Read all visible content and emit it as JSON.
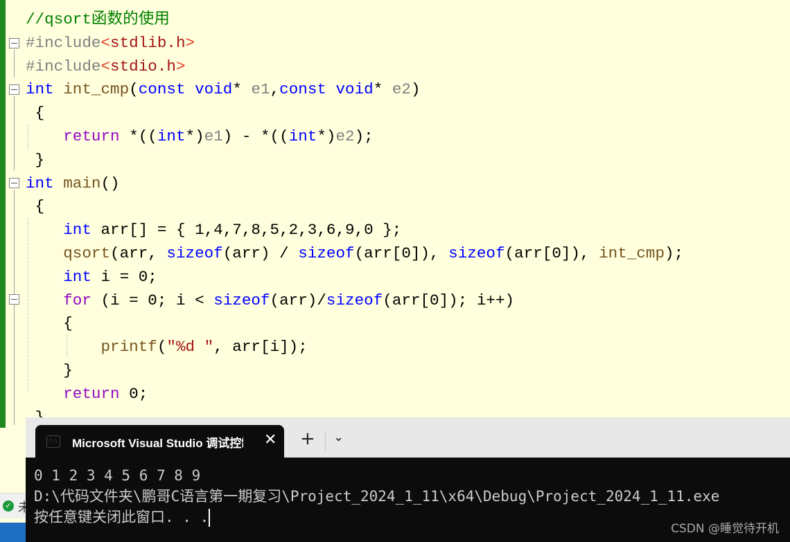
{
  "editor": {
    "lines": [
      [
        [
          "//qsort函数的使用",
          "c"
        ]
      ],
      [
        [
          "#include",
          "pp"
        ],
        [
          "<",
          "ang"
        ],
        [
          "stdlib.h",
          "inc"
        ],
        [
          ">",
          "ang"
        ]
      ],
      [
        [
          "#include",
          "pp"
        ],
        [
          "<",
          "ang"
        ],
        [
          "stdio.h",
          "inc"
        ],
        [
          ">",
          "ang"
        ]
      ],
      [
        [
          "int",
          "kw"
        ],
        [
          " ",
          "op"
        ],
        [
          "int_cmp",
          "fn"
        ],
        [
          "(",
          "op"
        ],
        [
          "const",
          "kw"
        ],
        [
          " ",
          "op"
        ],
        [
          "void",
          "kw"
        ],
        [
          "* ",
          "op"
        ],
        [
          "e1",
          "pr"
        ],
        [
          ",",
          "op"
        ],
        [
          "const",
          "kw"
        ],
        [
          " ",
          "op"
        ],
        [
          "void",
          "kw"
        ],
        [
          "* ",
          "op"
        ],
        [
          "e2",
          "pr"
        ],
        [
          ")",
          "op"
        ]
      ],
      [
        [
          " {",
          "op"
        ]
      ],
      [
        [
          "    ",
          "op"
        ],
        [
          "return",
          "rt"
        ],
        [
          " *((",
          "op"
        ],
        [
          "int",
          "kw"
        ],
        [
          "*)",
          "op"
        ],
        [
          "e1",
          "pr"
        ],
        [
          ") - *((",
          "op"
        ],
        [
          "int",
          "kw"
        ],
        [
          "*)",
          "op"
        ],
        [
          "e2",
          "pr"
        ],
        [
          ");",
          "op"
        ]
      ],
      [
        [
          " }",
          "op"
        ]
      ],
      [
        [
          "int",
          "kw"
        ],
        [
          " ",
          "op"
        ],
        [
          "main",
          "fn"
        ],
        [
          "()",
          "op"
        ]
      ],
      [
        [
          " {",
          "op"
        ]
      ],
      [
        [
          "    ",
          "op"
        ],
        [
          "int",
          "kw"
        ],
        [
          " arr[] = { 1,4,7,8,5,2,3,6,9,0 };",
          "op"
        ]
      ],
      [
        [
          "    ",
          "op"
        ],
        [
          "qsort",
          "fn"
        ],
        [
          "(arr, ",
          "op"
        ],
        [
          "sizeof",
          "kw"
        ],
        [
          "(arr) / ",
          "op"
        ],
        [
          "sizeof",
          "kw"
        ],
        [
          "(arr[0]), ",
          "op"
        ],
        [
          "sizeof",
          "kw"
        ],
        [
          "(arr[0]), ",
          "op"
        ],
        [
          "int_cmp",
          "fn"
        ],
        [
          ");",
          "op"
        ]
      ],
      [
        [
          "    ",
          "op"
        ],
        [
          "int",
          "kw"
        ],
        [
          " i = 0;",
          "op"
        ]
      ],
      [
        [
          "    ",
          "op"
        ],
        [
          "for",
          "rt"
        ],
        [
          " (i = 0; i < ",
          "op"
        ],
        [
          "sizeof",
          "kw"
        ],
        [
          "(arr)/",
          "op"
        ],
        [
          "sizeof",
          "kw"
        ],
        [
          "(arr[0]); i++)",
          "op"
        ]
      ],
      [
        [
          "    {",
          "op"
        ]
      ],
      [
        [
          "        ",
          "op"
        ],
        [
          "printf",
          "fn"
        ],
        [
          "(",
          "op"
        ],
        [
          "\"%d \"",
          "inc"
        ],
        [
          ", arr[i]);",
          "op"
        ]
      ],
      [
        [
          "    }",
          "op"
        ]
      ],
      [
        [
          "    ",
          "op"
        ],
        [
          "return",
          "rt"
        ],
        [
          " 0;",
          "op"
        ]
      ],
      [
        [
          " }",
          "op"
        ]
      ]
    ]
  },
  "terminal": {
    "tab_title": "Microsoft Visual Studio 调试控制台",
    "tab_icon": "C:\\",
    "close_label": "✕",
    "new_tab_label": "+",
    "dropdown_label": "⌄",
    "output": [
      "0 1 2 3 4 5 6 7 8 9",
      "D:\\代码文件夹\\鹏哥C语言第一期复习\\Project_2024_1_11\\x64\\Debug\\Project_2024_1_11.exe",
      "按任意键关闭此窗口. . ."
    ]
  },
  "status": {
    "text": "未"
  },
  "watermark": "CSDN @睡觉待开机",
  "colors": {
    "keyword": "#0000ff",
    "comment": "#008000",
    "function": "#74531f",
    "control": "#8f08c4",
    "string": "#a31515",
    "editor_bg": "#ffffdd",
    "terminal_bg": "#0c0c0c"
  }
}
